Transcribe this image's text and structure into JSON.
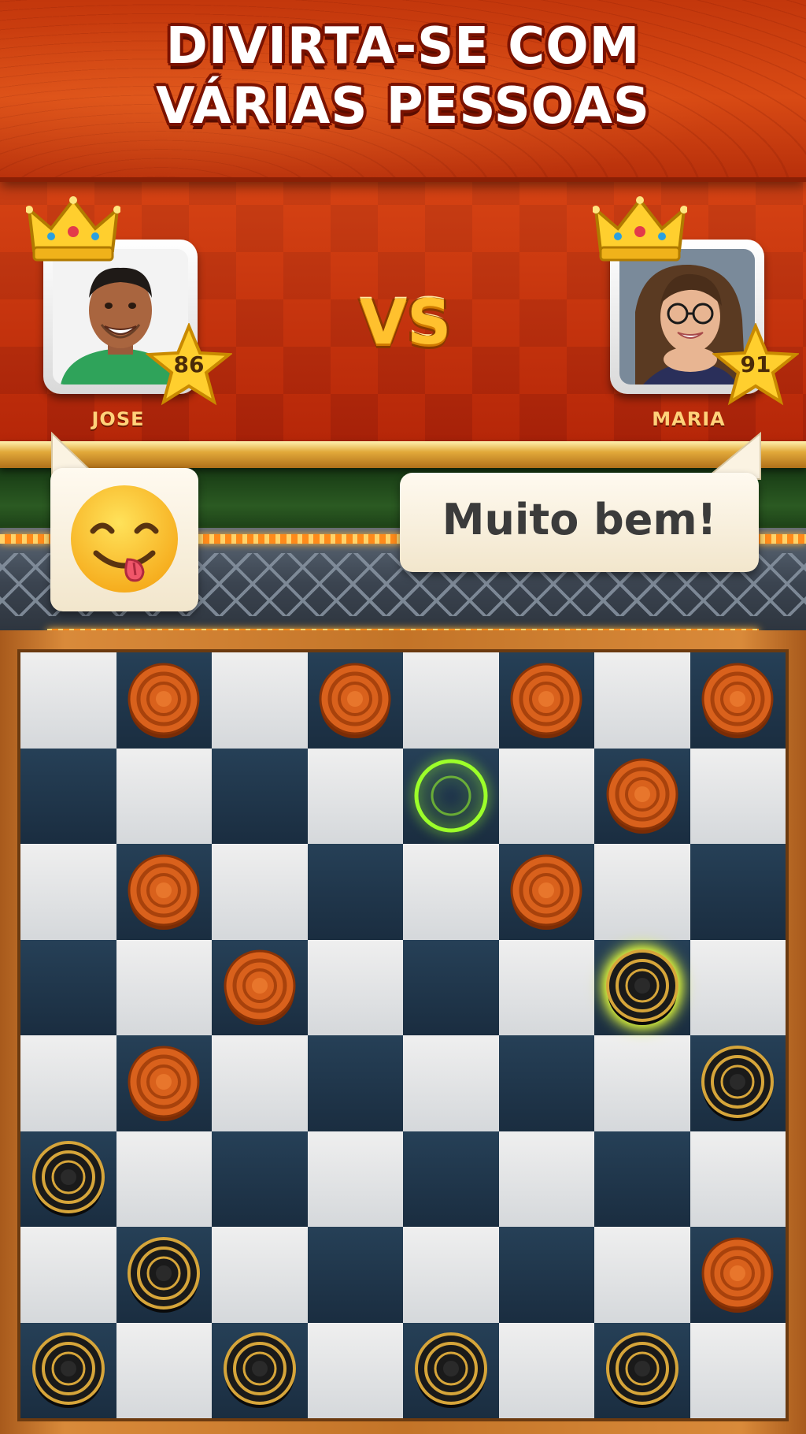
{
  "promo": {
    "headline_line1": "DIVIRTA-SE COM",
    "headline_line2": "VÁRIAS PESSOAS"
  },
  "match": {
    "vs_label": "VS",
    "player_left": {
      "name": "JOSE",
      "level": "86",
      "portrait_icon": "man-portrait-icon",
      "crown_icon": "crown-icon"
    },
    "player_right": {
      "name": "MARIA",
      "level": "91",
      "portrait_icon": "woman-portrait-icon",
      "crown_icon": "crown-icon"
    }
  },
  "chat": {
    "left_bubble_icon": "yum-face-emoji-icon",
    "right_bubble_text": "Muito bem!"
  },
  "board": {
    "size": 8,
    "light_color": "#e6e6e6",
    "dark_color": "#1f364c",
    "pieces": [
      {
        "row": 0,
        "col": 1,
        "color": "orange"
      },
      {
        "row": 0,
        "col": 3,
        "color": "orange"
      },
      {
        "row": 0,
        "col": 5,
        "color": "orange"
      },
      {
        "row": 0,
        "col": 7,
        "color": "orange"
      },
      {
        "row": 1,
        "col": 6,
        "color": "orange"
      },
      {
        "row": 2,
        "col": 1,
        "color": "orange"
      },
      {
        "row": 2,
        "col": 5,
        "color": "orange"
      },
      {
        "row": 3,
        "col": 2,
        "color": "orange"
      },
      {
        "row": 3,
        "col": 6,
        "color": "black",
        "selected": true
      },
      {
        "row": 4,
        "col": 1,
        "color": "orange"
      },
      {
        "row": 4,
        "col": 7,
        "color": "black"
      },
      {
        "row": 5,
        "col": 0,
        "color": "black"
      },
      {
        "row": 6,
        "col": 1,
        "color": "black"
      },
      {
        "row": 6,
        "col": 7,
        "color": "orange"
      },
      {
        "row": 7,
        "col": 0,
        "color": "black"
      },
      {
        "row": 7,
        "col": 2,
        "color": "black"
      },
      {
        "row": 7,
        "col": 4,
        "color": "black"
      },
      {
        "row": 7,
        "col": 6,
        "color": "black"
      }
    ],
    "move_hints": [
      {
        "row": 1,
        "col": 4
      }
    ],
    "colors": {
      "orange_piece": "#d9611c",
      "black_piece": "#1a1a1a",
      "gold_rim": "#d6a53a",
      "selected_glow": "#e6ff3a",
      "hint_ring": "#9cff2a"
    }
  }
}
